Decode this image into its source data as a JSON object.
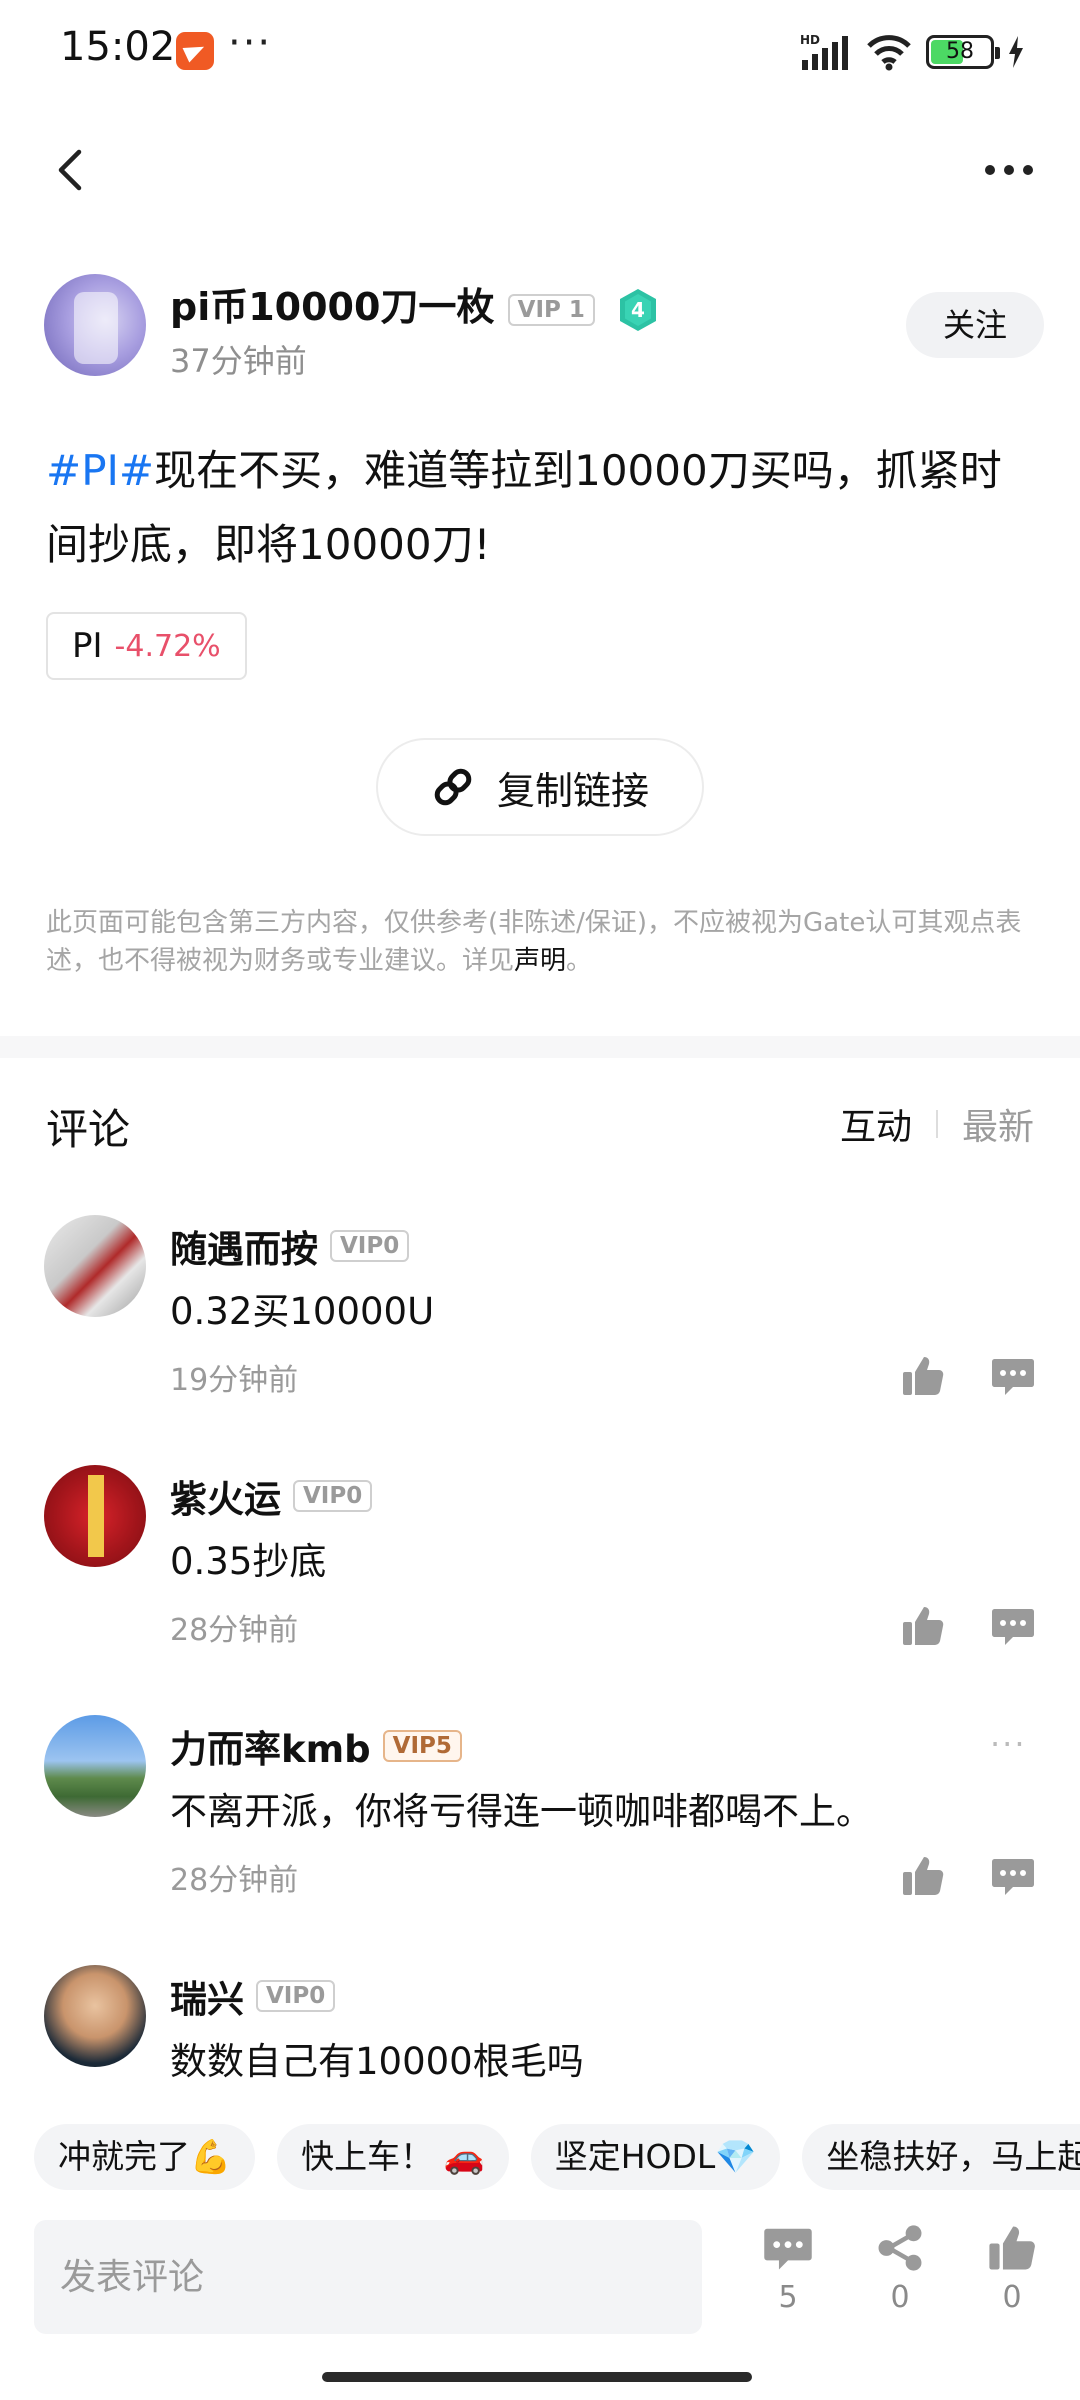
{
  "status_bar": {
    "time": "15:02",
    "dots": "···",
    "network_label": "HD",
    "battery_level": "58",
    "battery_fraction": 0.58
  },
  "post": {
    "author_name": "pi币10000刀一枚",
    "author_vip": "VIP 1",
    "author_level": "4",
    "time_ago": "37分钟前",
    "follow_label": "关注",
    "tag": "#PI#",
    "text": "现在不买，难道等拉到10000刀买吗，抓紧时间抄底，即将10000刀!",
    "coin_name": "PI",
    "coin_change": "-4.72%",
    "copy_link_label": "复制链接",
    "disclaimer_text": "此页面可能包含第三方内容，仅供参考(非陈述/保证)，不应被视为Gate认可其观点表述，也不得被视为财务或专业建议。详见",
    "disclaimer_link": "声明",
    "disclaimer_end": "。"
  },
  "comments_section": {
    "title": "评论",
    "sort_tabs": [
      "互动",
      "最新"
    ]
  },
  "comments": [
    {
      "name": "随遇而按",
      "vip": "VIP0",
      "text": "0.32买10000U",
      "time": "19分钟前"
    },
    {
      "name": "紫火运",
      "vip": "VIP0",
      "text": "0.35抄底",
      "time": "28分钟前"
    },
    {
      "name": "力而率kmb",
      "vip": "VIP5",
      "text": "不离开派，你将亏得连一顿咖啡都喝不上。",
      "time": "28分钟前",
      "more": "···"
    },
    {
      "name": "瑞兴",
      "vip": "VIP0",
      "text": "数数自己有10000根毛吗"
    }
  ],
  "quick_replies": [
    "冲就完了💪",
    "快上车！ 🚗",
    "坚定HODL💎",
    "坐稳扶好，马上起飞"
  ],
  "bottom_bar": {
    "input_placeholder": "发表评论",
    "comments_count": "5",
    "shares_count": "0",
    "likes_count": "0"
  },
  "colors": {
    "accent_blue": "#1976f2",
    "negative_red": "#e8506a",
    "level_badge": "#2cc2a4"
  }
}
